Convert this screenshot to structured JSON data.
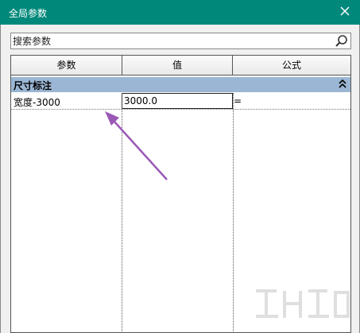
{
  "window": {
    "title": "全局参数"
  },
  "search": {
    "placeholder": "搜索参数"
  },
  "table": {
    "columns": [
      "参数",
      "值",
      "公式"
    ],
    "group": {
      "label": "尺寸标注"
    },
    "rows": [
      {
        "name": "宽度-3000",
        "value": "3000.0",
        "formula": "="
      }
    ]
  },
  "colors": {
    "titlebar": "#00897b",
    "group_header": "#9bb6d4",
    "arrow": "#9b59b6"
  },
  "icons": [
    "close-icon",
    "search-icon",
    "collapse-icon",
    "arrow-annotation"
  ]
}
